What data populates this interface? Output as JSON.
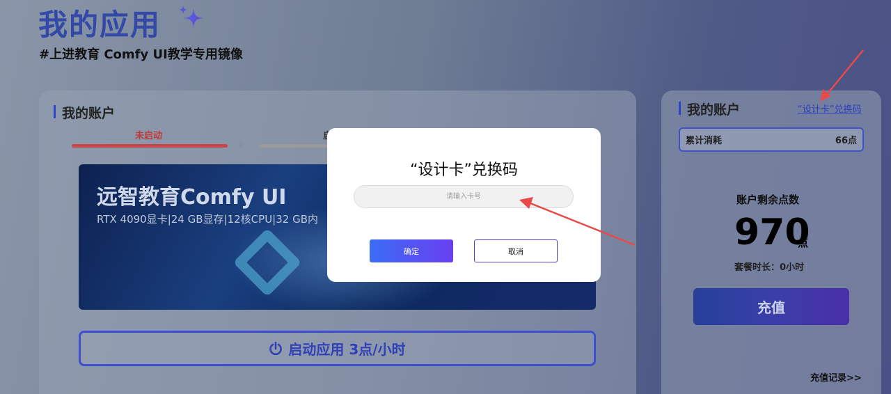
{
  "header": {
    "title": "我的应用",
    "subtitle": "#上进教育 Comfy UI教学专用镜像"
  },
  "left_card": {
    "heading": "我的账户",
    "status": "未启动",
    "step2_partial": "启",
    "banner": {
      "title": "远智教育Comfy UI",
      "spec": "RTX 4090显卡|24 GB显存|12核CPU|32 GB内"
    },
    "launch_button": "启动应用 3点/小时"
  },
  "right_card": {
    "heading": "我的账户",
    "redeem_link": "“设计卡”兑换码",
    "usage": {
      "label": "累计消耗",
      "value": "66点"
    },
    "balance_label": "账户剩余点数",
    "balance_value": "970",
    "balance_unit": "点",
    "package_time": "套餐时长：0小时",
    "recharge_button": "充值",
    "recharge_record": "充值记录>>"
  },
  "modal": {
    "title": "“设计卡”兑换码",
    "input_placeholder": "请输入卡号",
    "input_value": "",
    "ok_button": "确定",
    "cancel_button": "取消"
  },
  "colors": {
    "accent": "#2d44c8",
    "status_red": "#c84646",
    "annotation_arrow": "#e84a4a"
  },
  "icons": [
    "sparkle-icon",
    "power-icon",
    "annotation-arrow-icon"
  ]
}
